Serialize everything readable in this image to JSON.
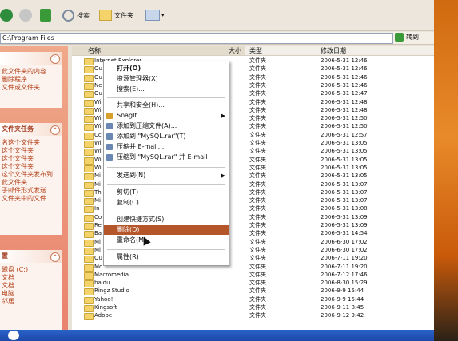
{
  "toolbar": {
    "search_label": "搜索",
    "folders_label": "文件夹"
  },
  "address": {
    "path": "C:\\Program Files",
    "go_label": "转到"
  },
  "left_panel": {
    "panel1_items": [
      "此文件夹的内容",
      "删除程序",
      "文件或文件夹"
    ],
    "panel2_title": "文件夹任务",
    "panel2_items": [
      "名这个文件夹",
      "这个文件夹",
      "这个文件夹",
      "这个文件夹",
      "这个文件夹发布到",
      "此文件夹",
      "子邮件形式发送",
      "文件夹中的文件"
    ],
    "panel3_title": "置",
    "panel3_items": [
      "磁盘 (C:)",
      "文档",
      "文档",
      "电脑",
      "邻居"
    ]
  },
  "columns": {
    "name": "名称",
    "size": "大小",
    "type": "类型",
    "modified": "修改日期"
  },
  "files": [
    {
      "name": "Internet Explorer",
      "type": "文件夹",
      "date": "2006-5-31 12:46"
    },
    {
      "name": "Ou",
      "type": "文件夹",
      "date": "2006-5-31 12:46"
    },
    {
      "name": "Ou",
      "type": "文件夹",
      "date": "2006-5-31 12:46"
    },
    {
      "name": "Ne",
      "type": "文件夹",
      "date": "2006-5-31 12:46"
    },
    {
      "name": "Ou",
      "type": "文件夹",
      "date": "2006-5-31 12:47"
    },
    {
      "name": "Wi",
      "type": "文件夹",
      "date": "2006-5-31 12:48"
    },
    {
      "name": "Wi",
      "type": "文件夹",
      "date": "2006-5-31 12:48"
    },
    {
      "name": "Wi",
      "type": "文件夹",
      "date": "2006-5-31 12:50"
    },
    {
      "name": "Wi",
      "type": "文件夹",
      "date": "2006-5-31 12:50"
    },
    {
      "name": "Cc",
      "type": "文件夹",
      "date": "2006-5-31 12:57"
    },
    {
      "name": "Wi",
      "type": "文件夹",
      "date": "2006-5-31 13:05"
    },
    {
      "name": "Wi",
      "type": "文件夹",
      "date": "2006-5-31 13:05"
    },
    {
      "name": "Wi",
      "type": "文件夹",
      "date": "2006-5-31 13:05"
    },
    {
      "name": "Wi",
      "type": "文件夹",
      "date": "2006-5-31 13:05"
    },
    {
      "name": "Mi",
      "type": "文件夹",
      "date": "2006-5-31 13:05"
    },
    {
      "name": "Mi",
      "type": "文件夹",
      "date": "2006-5-31 13:07"
    },
    {
      "name": "Th",
      "type": "文件夹",
      "date": "2006-5-31 13:07"
    },
    {
      "name": "Mi",
      "type": "文件夹",
      "date": "2006-5-31 13:07"
    },
    {
      "name": "In",
      "type": "文件夹",
      "date": "2006-5-31 13:08"
    },
    {
      "name": "Co",
      "type": "文件夹",
      "date": "2006-5-31 13:09"
    },
    {
      "name": "Re",
      "type": "文件夹",
      "date": "2006-5-31 13:09"
    },
    {
      "name": "Ba",
      "type": "文件夹",
      "date": "2006-5-31 14:54"
    },
    {
      "name": "Mi",
      "type": "文件夹",
      "date": "2006-6-30 17:02"
    },
    {
      "name": "Mi",
      "type": "文件夹",
      "date": "2006-6-30 17:02"
    },
    {
      "name": "Ou",
      "type": "文件夹",
      "date": "2006-7-11 19:20"
    },
    {
      "name": "Mo",
      "type": "文件夹",
      "date": "2006-7-11 19:20"
    },
    {
      "name": "Macromedia",
      "type": "文件夹",
      "date": "2006-7-12 17:46"
    },
    {
      "name": "baidu",
      "type": "文件夹",
      "date": "2006-8-30 15:29"
    },
    {
      "name": "Ringz Studio",
      "type": "文件夹",
      "date": "2006-9-9 15:44"
    },
    {
      "name": "Yahoo!",
      "type": "文件夹",
      "date": "2006-9-9 15:44"
    },
    {
      "name": "Kingsoft",
      "type": "文件夹",
      "date": "2006-9-11 8:45"
    },
    {
      "name": "Adobe",
      "type": "文件夹",
      "date": "2006-9-12 9:42"
    }
  ],
  "context_menu": {
    "open": "打开(O)",
    "explorer": "资源管理器(X)",
    "search": "搜索(E)...",
    "share": "共享和安全(H)...",
    "snagit": "SnagIt",
    "add_archive": "添加到压缩文件(A)...",
    "add_rar": "添加到 \"MySQL.rar\"(T)",
    "compress_email": "压缩并 E-mail...",
    "compress_rar_email": "压缩到 \"MySQL.rar\" 并 E-mail",
    "send_to": "发送到(N)",
    "cut": "剪切(T)",
    "copy": "复制(C)",
    "create_shortcut": "创建快捷方式(S)",
    "delete": "删除(D)",
    "rename": "重命名(M)",
    "properties": "属性(R)"
  },
  "colors": {
    "highlight": "#b4552a",
    "panel_header_text": "#a33c1f"
  }
}
